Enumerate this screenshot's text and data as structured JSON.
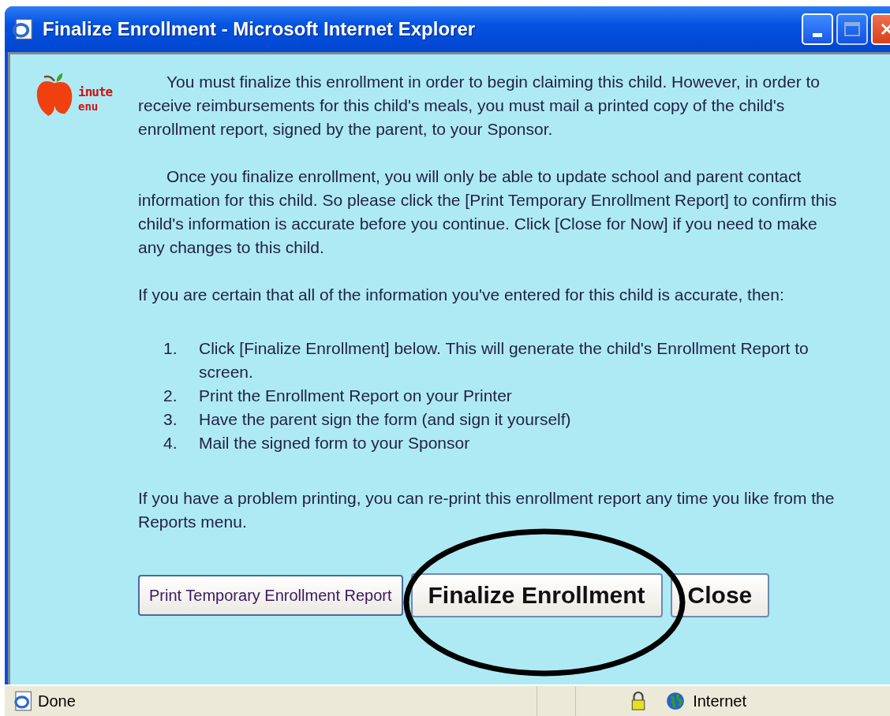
{
  "window": {
    "title": "Finalize Enrollment - Microsoft Internet Explorer"
  },
  "logo": {
    "line_1": "inute",
    "line_2": "enu"
  },
  "paragraphs": [
    "You must finalize this enrollment in order to begin claiming this child. However, in order to receive reimbursements for this child's meals, you must mail a printed copy of the child's enrollment report, signed by the parent, to your Sponsor.",
    "Once you finalize enrollment, you will only be able to update school and parent contact information for this child. So please click the [Print Temporary Enrollment Report] to confirm this child's information is accurate before you continue. Click [Close for Now] if you need to make any changes to this child.",
    "If you are certain that all of the information you've entered for this child is accurate, then:"
  ],
  "steps": [
    {
      "number": "1.",
      "text": "Click [Finalize Enrollment] below. This will generate the child's Enrollment Report to screen."
    },
    {
      "number": "2.",
      "text": "Print the Enrollment Report on your Printer"
    },
    {
      "number": "3.",
      "text": "Have the parent sign the form (and sign it yourself)"
    },
    {
      "number": "4.",
      "text": "Mail the signed form to your Sponsor"
    }
  ],
  "footer_text": "If you have a problem printing, you can re-print this enrollment report any time you like from the Reports menu.",
  "buttons": [
    {
      "label": "Print Temporary Enrollment Report",
      "kind": "small"
    },
    {
      "label": "Finalize Enrollment",
      "kind": "large"
    },
    {
      "label": "Close",
      "kind": "large"
    }
  ],
  "status_bar": {
    "status": "Done",
    "zone": "Internet"
  }
}
